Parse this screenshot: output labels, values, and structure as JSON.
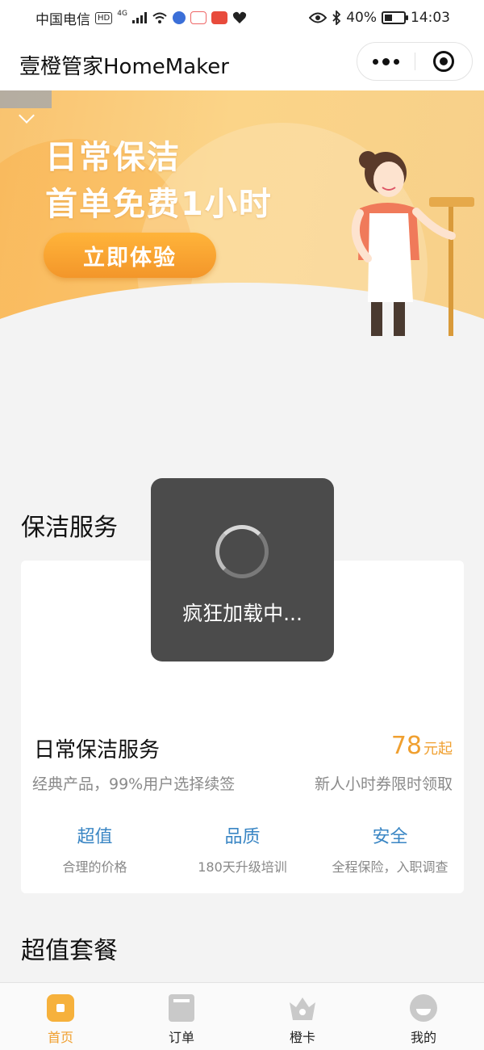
{
  "status_bar": {
    "carrier": "中国电信",
    "hd_badge": "HD",
    "network": "4G",
    "battery_percent": "40%",
    "time": "14:03",
    "battery_level": 0.4
  },
  "nav": {
    "title": "壹橙管家HomeMaker"
  },
  "banner": {
    "line1": "日常保洁",
    "line2": "首单免费1小时",
    "button_label": "立即体验"
  },
  "sections": {
    "cleaning_title": "保洁服务",
    "package_title": "超值套餐"
  },
  "service_card": {
    "name": "日常保洁服务",
    "price_value": "78",
    "price_unit": "元起",
    "description": "经典产品，99%用户选择续签",
    "promo": "新人小时券限时领取",
    "features": [
      {
        "title": "超值",
        "subtitle": "合理的价格"
      },
      {
        "title": "品质",
        "subtitle": "180天升级培训"
      },
      {
        "title": "安全",
        "subtitle": "全程保险，入职调查"
      }
    ]
  },
  "loading": {
    "text": "疯狂加载中..."
  },
  "tabbar": {
    "items": [
      {
        "label": "首页",
        "icon": "home-icon",
        "active": true
      },
      {
        "label": "订单",
        "icon": "order-icon",
        "active": false
      },
      {
        "label": "橙卡",
        "icon": "crown-card-icon",
        "active": false
      },
      {
        "label": "我的",
        "icon": "profile-icon",
        "active": false
      }
    ]
  },
  "colors": {
    "accent": "#f0a030",
    "feature_blue": "#3a86c4",
    "toast_bg": "#4b4b4b"
  }
}
